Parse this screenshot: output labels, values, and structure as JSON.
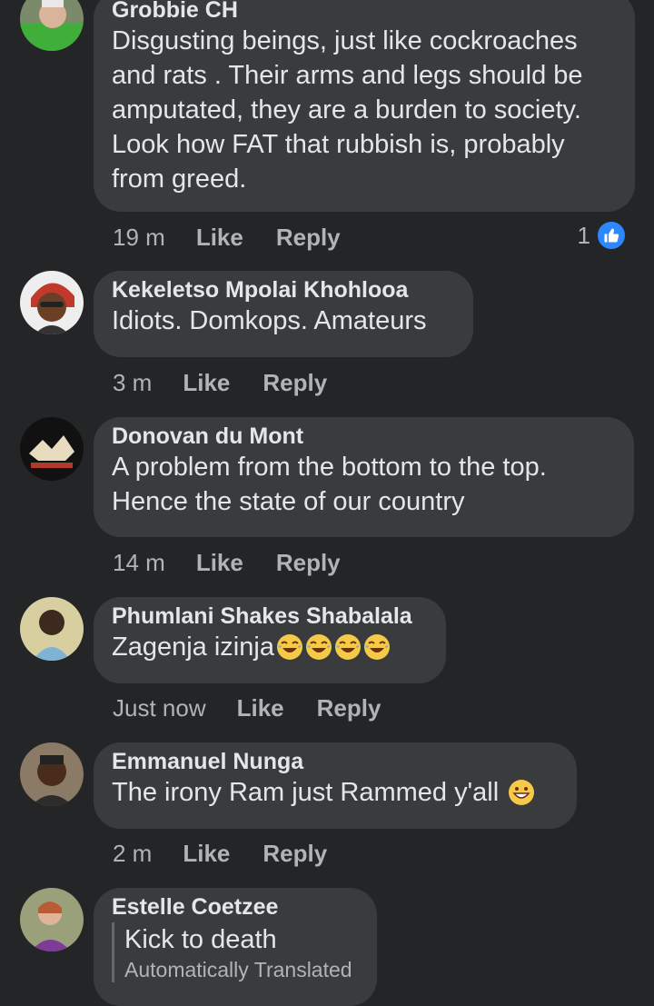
{
  "actions": {
    "like": "Like",
    "reply": "Reply"
  },
  "comments": [
    {
      "author": "Grobbie CH",
      "lines": [
        "Disgusting beings, just like cockroaches",
        "and rats . Their arms and legs should be",
        "amputated, they are a burden to society.",
        "Look how FAT that rubbish is, probably",
        "from greed."
      ],
      "time": "19 m",
      "reaction_count": "1"
    },
    {
      "author": "Kekeletso Mpolai Khohlooa",
      "lines": [
        "Idiots. Domkops. Amateurs"
      ],
      "time": "3 m"
    },
    {
      "author": "Donovan du Mont",
      "lines": [
        "A problem from the bottom to the top.",
        "Hence the state of our country"
      ],
      "time": "14 m"
    },
    {
      "author": "Phumlani Shakes Shabalala",
      "lines": [
        "Zagenja izinja"
      ],
      "emoji": "face-with-tears-of-joy x4",
      "time": "Just now"
    },
    {
      "author": "Emmanuel Nunga",
      "lines": [
        "The irony Ram just Rammed y'all"
      ],
      "emoji": "grinning-face",
      "time": "2 m"
    },
    {
      "author": "Estelle Coetzee",
      "lines": [
        "Kick to death"
      ],
      "translated_note": "Automatically Translated"
    }
  ],
  "colors": {
    "background": "#242526",
    "bubble": "#3a3b3c",
    "like_blue": "#2d88ff",
    "secondary_text": "#b0b3b8"
  }
}
